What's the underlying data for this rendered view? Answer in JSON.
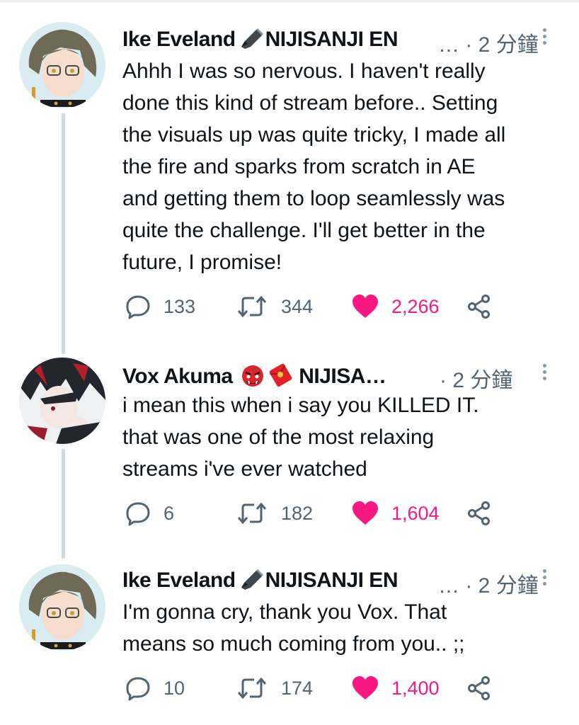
{
  "tweets": [
    {
      "name": "Ike Eveland",
      "name_suffix": "NIJISANJI EN",
      "ellipsis": "…",
      "time": "· 2 分鐘",
      "text": "Ahhh I was so nervous. I haven't really\ndone this kind of stream before.. Setting\nthe visuals up was quite tricky, I made all\nthe fire and sparks from scratch in AE\nand getting them to loop seamlessly was\nquite the challenge. I'll get better in the\nfuture, I promise!",
      "replies": "133",
      "retweets": "344",
      "likes": "2,266",
      "liked": true
    },
    {
      "name": "Vox Akuma",
      "name_suffix": "NIJISA…",
      "ellipsis": "",
      "time": "· 2 分鐘",
      "text": "i mean this when i say you KILLED IT.\nthat was one of the most relaxing\nstreams i've ever watched",
      "replies": "6",
      "retweets": "182",
      "likes": "1,604",
      "liked": true
    },
    {
      "name": "Ike Eveland",
      "name_suffix": "NIJISANJI EN",
      "ellipsis": "…",
      "time": "· 2 分鐘",
      "text": "I'm gonna cry, thank you Vox. That\nmeans so much coming from you.. ;;",
      "replies": "10",
      "retweets": "174",
      "likes": "1,400",
      "liked": true
    }
  ],
  "icons": {
    "pen": "fountain-pen-icon",
    "oni": "ogre-emoji-icon",
    "envelope": "red-envelope-emoji-icon",
    "reply": "reply-icon",
    "retweet": "retweet-icon",
    "like": "heart-icon",
    "share": "share-icon",
    "more": "more-icon"
  },
  "colors": {
    "like_active": "#f91880",
    "muted_text": "#536471",
    "thread_line": "#cfd9de"
  }
}
